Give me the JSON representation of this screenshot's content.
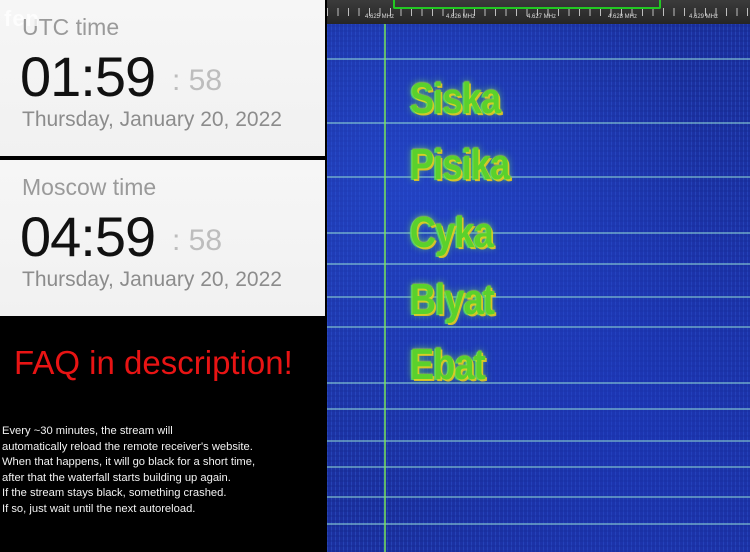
{
  "watermark": "fen",
  "utc": {
    "label": "UTC time",
    "time": "01:59",
    "seconds": "58",
    "date": "Thursday, January 20, 2022"
  },
  "moscow": {
    "label": "Moscow time",
    "time": "04:59",
    "seconds": "58",
    "date": "Thursday, January 20, 2022"
  },
  "faq": "FAQ in description!",
  "notice": [
    "Every ~30 minutes, the stream will",
    "automatically reload the remote receiver's website.",
    "When that happens, it will go black for a short time,",
    "after that the waterfall starts building up again.",
    "If the stream stays black, something crashed.",
    "If so, just wait until the next autoreload."
  ],
  "waterfall": {
    "freq_labels": [
      "4.625 MHz",
      "4.626 MHz",
      "4.627 MHz",
      "4.628 MHz",
      "4.629 MHz"
    ],
    "words": [
      "Siska",
      "Pisika",
      "Cyka",
      "Blyat",
      "Ebat"
    ],
    "colors": {
      "background": "#1b309f",
      "passband": "#22c922",
      "signal": "#5ad12c"
    }
  }
}
